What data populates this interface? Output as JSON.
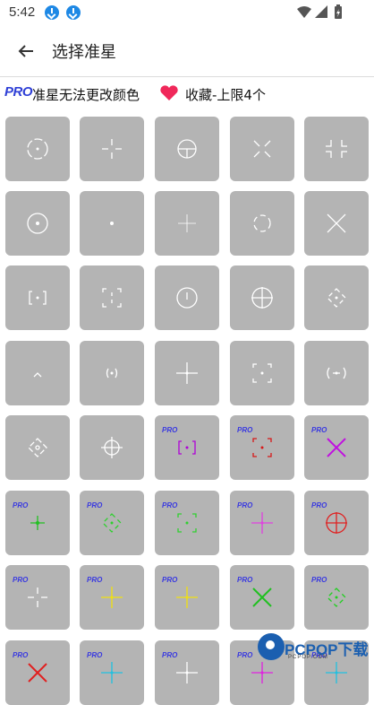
{
  "status_bar": {
    "time": "5:42"
  },
  "app_bar": {
    "title": "选择准星"
  },
  "info": {
    "pro_badge": "PRO",
    "pro_text": "准星无法更改颜色",
    "fav_text": "收藏-上限4个"
  },
  "tiles": [
    {
      "style": "ring-dot-gap"
    },
    {
      "style": "cross-gap"
    },
    {
      "style": "circle-cross"
    },
    {
      "style": "x-gap"
    },
    {
      "style": "corner-cross"
    },
    {
      "style": "circle-dot"
    },
    {
      "style": "dot"
    },
    {
      "style": "cross-thin"
    },
    {
      "style": "circle-gap-small"
    },
    {
      "style": "x-big"
    },
    {
      "style": "bracket-dot"
    },
    {
      "style": "corner-box"
    },
    {
      "style": "circle-dot-top"
    },
    {
      "style": "circle-cross-full"
    },
    {
      "style": "diamond-dot"
    },
    {
      "style": "chevron"
    },
    {
      "style": "dot-paren"
    },
    {
      "style": "cross-full"
    },
    {
      "style": "corner-box-dot"
    },
    {
      "style": "paren-cross"
    },
    {
      "style": "diamond-gap"
    },
    {
      "style": "scope"
    },
    {
      "style": "bracket-dot",
      "pro": true,
      "color": "#b000d8"
    },
    {
      "style": "corner-box-dot",
      "pro": true,
      "color": "#d81818"
    },
    {
      "style": "x-full",
      "pro": true,
      "color": "#c010e0"
    },
    {
      "style": "cross-dot",
      "pro": true,
      "color": "#22c022"
    },
    {
      "style": "diamond-dot",
      "pro": true,
      "color": "#30d030"
    },
    {
      "style": "corner-box-dot",
      "pro": true,
      "color": "#30d030"
    },
    {
      "style": "cross-full",
      "pro": true,
      "color": "#e040e0"
    },
    {
      "style": "circle-cross-full",
      "pro": true,
      "color": "#e02020"
    },
    {
      "style": "cross-gap",
      "pro": true,
      "color": "#ffffff"
    },
    {
      "style": "cross-full",
      "pro": true,
      "color": "#f0e010"
    },
    {
      "style": "cross-full",
      "pro": true,
      "color": "#f0e010"
    },
    {
      "style": "x-full",
      "pro": true,
      "color": "#20c020"
    },
    {
      "style": "diamond-dot",
      "pro": true,
      "color": "#20d020"
    },
    {
      "style": "x-full",
      "pro": true,
      "color": "#e02020"
    },
    {
      "style": "cross-full",
      "pro": true,
      "color": "#20c0e0"
    },
    {
      "style": "cross-full",
      "pro": true,
      "color": "#ffffff"
    },
    {
      "style": "cross-full",
      "pro": true,
      "color": "#e020e0"
    },
    {
      "style": "cross-full",
      "pro": true,
      "color": "#20c0e0"
    }
  ],
  "pro_label": "PRO",
  "watermark": {
    "name": "PCPOP下载",
    "sub": "PCPOP.COM"
  },
  "colors": {
    "tile_bg": "#b4b4b4",
    "pro_blue": "#2e3fd6",
    "heart": "#f0285a"
  }
}
